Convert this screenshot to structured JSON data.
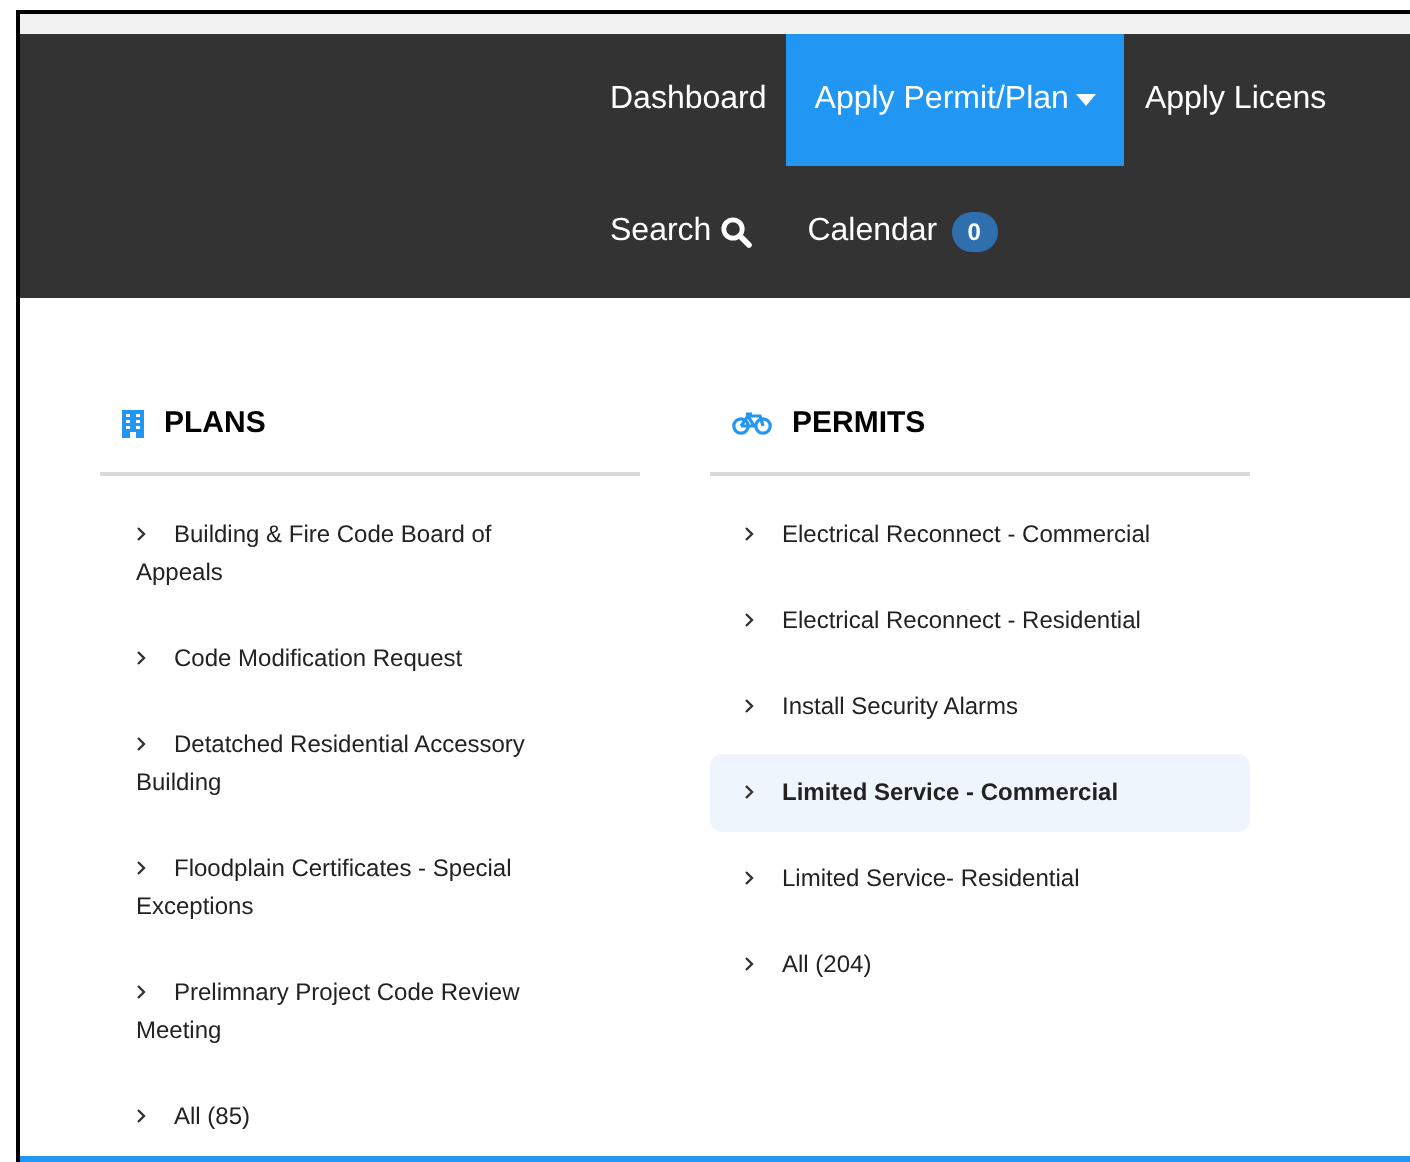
{
  "nav": {
    "rows": [
      [
        {
          "label": "Dashboard",
          "selected": false,
          "kind": "link"
        },
        {
          "label": "Apply Permit/Plan",
          "selected": true,
          "kind": "dropdown"
        },
        {
          "label": "Apply Licens",
          "selected": false,
          "kind": "link"
        }
      ],
      [
        {
          "label": "Search",
          "selected": false,
          "kind": "search"
        },
        {
          "label": "Calendar",
          "selected": false,
          "kind": "badge",
          "badge": "0"
        }
      ]
    ]
  },
  "menu": {
    "columns": [
      {
        "title": "PLANS",
        "kind": "building",
        "items": [
          {
            "label": "Building & Fire Code Board of Appeals",
            "selected": false
          },
          {
            "label": "Code Modification Request",
            "selected": false
          },
          {
            "label": "Detatched Residential Accessory Building",
            "selected": false
          },
          {
            "label": "Floodplain Certificates - Special Exceptions",
            "selected": false
          },
          {
            "label": "Prelimnary Project Code Review Meeting",
            "selected": false
          },
          {
            "label": "All (85)",
            "selected": false
          }
        ]
      },
      {
        "title": "PERMITS",
        "kind": "bicycle",
        "items": [
          {
            "label": "Electrical Reconnect - Commercial",
            "selected": false
          },
          {
            "label": "Electrical Reconnect - Residential",
            "selected": false
          },
          {
            "label": "Install Security Alarms",
            "selected": false
          },
          {
            "label": "Limited Service - Commercial",
            "selected": true
          },
          {
            "label": "Limited Service- Residential",
            "selected": false
          },
          {
            "label": "All (204)",
            "selected": false
          }
        ]
      }
    ]
  }
}
